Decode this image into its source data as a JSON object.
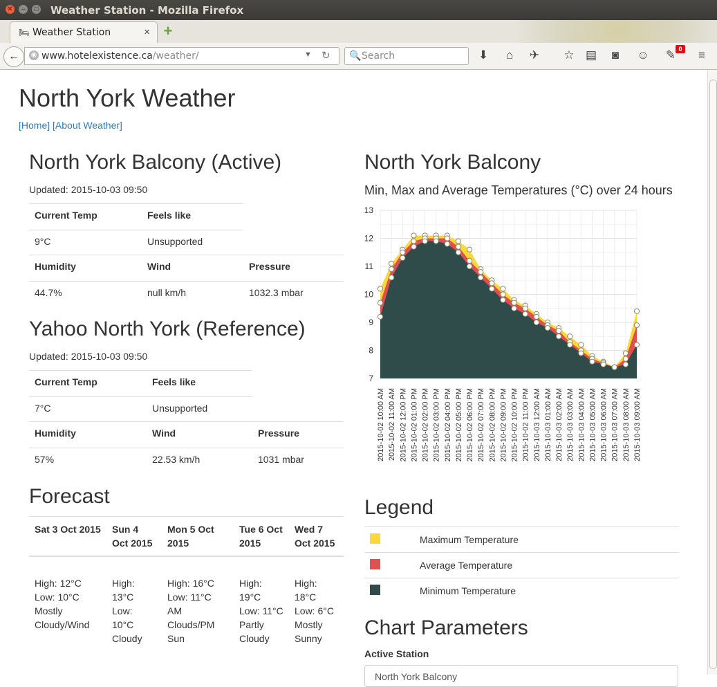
{
  "window": {
    "title": "Weather Station - Mozilla Firefox"
  },
  "tab": {
    "label": "Weather Station"
  },
  "address": {
    "host": "www.hotelexistence.ca",
    "path": "/weather/"
  },
  "search": {
    "placeholder": "Search"
  },
  "toolbar": {
    "badge_count": "0"
  },
  "page": {
    "title": "North York Weather",
    "nav": {
      "home": "[Home]",
      "about": "[About Weather]"
    }
  },
  "station1": {
    "name": "North York Balcony (Active)",
    "updated": "Updated: 2015-10-03 09:50",
    "labels": {
      "current_temp": "Current Temp",
      "feels_like": "Feels like",
      "humidity": "Humidity",
      "wind": "Wind",
      "pressure": "Pressure"
    },
    "values": {
      "current_temp": "9°C",
      "feels_like": "Unsupported",
      "humidity": "44.7%",
      "wind": "null km/h",
      "pressure": "1032.3 mbar"
    }
  },
  "station2": {
    "name": "Yahoo North York (Reference)",
    "updated": "Updated: 2015-10-03 09:50",
    "labels": {
      "current_temp": "Current Temp",
      "feels_like": "Feels like",
      "humidity": "Humidity",
      "wind": "Wind",
      "pressure": "Pressure"
    },
    "values": {
      "current_temp": "7°C",
      "feels_like": "Unsupported",
      "humidity": "57%",
      "wind": "22.53 km/h",
      "pressure": "1031 mbar"
    }
  },
  "forecast": {
    "title": "Forecast",
    "days": [
      {
        "date": "Sat 3 Oct 2015",
        "high": "High: 12°C",
        "low": "Low: 10°C",
        "cond": "Mostly Cloudy/Wind"
      },
      {
        "date": "Sun 4 Oct 2015",
        "high": "High: 13°C",
        "low": "Low: 10°C",
        "cond": "Cloudy"
      },
      {
        "date": "Mon 5 Oct 2015",
        "high": "High: 16°C",
        "low": "Low: 11°C",
        "cond": "AM Clouds/PM Sun"
      },
      {
        "date": "Tue 6 Oct 2015",
        "high": "High: 19°C",
        "low": "Low: 11°C",
        "cond": "Partly Cloudy"
      },
      {
        "date": "Wed 7 Oct 2015",
        "high": "High: 18°C",
        "low": "Low: 6°C",
        "cond": "Mostly Sunny"
      }
    ]
  },
  "chart_section": {
    "title": "North York Balcony"
  },
  "chart_data": {
    "type": "area",
    "title": "Min, Max and Average Temperatures (°C) over 24 hours",
    "ylim": [
      7,
      13
    ],
    "yticks": [
      "7",
      "8",
      "9",
      "10",
      "11",
      "12",
      "13"
    ],
    "grid": true,
    "colors": {
      "max": "#f9d83a",
      "avg": "#e05050",
      "min": "#2f4b4a"
    },
    "x": [
      "2015-10-02 10:00 AM",
      "2015-10-02 11:00 AM",
      "2015-10-02 12:00 PM",
      "2015-10-02 01:00 PM",
      "2015-10-02 02:00 PM",
      "2015-10-02 03:00 PM",
      "2015-10-02 04:00 PM",
      "2015-10-02 05:00 PM",
      "2015-10-02 06:00 PM",
      "2015-10-02 07:00 PM",
      "2015-10-02 08:00 PM",
      "2015-10-02 09:00 PM",
      "2015-10-02 10:00 PM",
      "2015-10-02 11:00 PM",
      "2015-10-03 12:00 AM",
      "2015-10-03 01:00 AM",
      "2015-10-03 02:00 AM",
      "2015-10-03 03:00 AM",
      "2015-10-03 04:00 AM",
      "2015-10-03 05:00 AM",
      "2015-10-03 06:00 AM",
      "2015-10-03 07:00 AM",
      "2015-10-03 08:00 AM",
      "2015-10-03 09:00 AM"
    ],
    "series": [
      {
        "name": "Maximum Temperature",
        "values": [
          10.2,
          11.1,
          11.6,
          12.1,
          12.1,
          12.1,
          12.1,
          11.9,
          11.6,
          10.9,
          10.5,
          10.2,
          9.8,
          9.6,
          9.3,
          9.0,
          8.8,
          8.5,
          8.2,
          7.8,
          7.6,
          7.4,
          7.9,
          9.4
        ]
      },
      {
        "name": "Average Temperature",
        "values": [
          9.7,
          10.9,
          11.5,
          11.9,
          12.0,
          12.0,
          12.0,
          11.7,
          11.2,
          10.8,
          10.4,
          10.0,
          9.7,
          9.5,
          9.2,
          8.9,
          8.7,
          8.3,
          8.0,
          7.7,
          7.55,
          7.4,
          7.7,
          8.9
        ]
      },
      {
        "name": "Minimum Temperature",
        "values": [
          9.2,
          10.6,
          11.3,
          11.7,
          11.9,
          11.9,
          11.8,
          11.5,
          11.0,
          10.6,
          10.2,
          9.8,
          9.5,
          9.3,
          9.0,
          8.8,
          8.5,
          8.2,
          7.9,
          7.6,
          7.5,
          7.4,
          7.5,
          8.2
        ]
      }
    ]
  },
  "legend": {
    "title": "Legend",
    "items": [
      {
        "label": "Maximum Temperature",
        "color": "#f9d83a"
      },
      {
        "label": "Average Temperature",
        "color": "#e05050"
      },
      {
        "label": "Minimum Temperature",
        "color": "#2f4b4a"
      }
    ]
  },
  "params": {
    "title": "Chart Parameters",
    "active_station_label": "Active Station",
    "active_station_value": "North York Balcony"
  }
}
